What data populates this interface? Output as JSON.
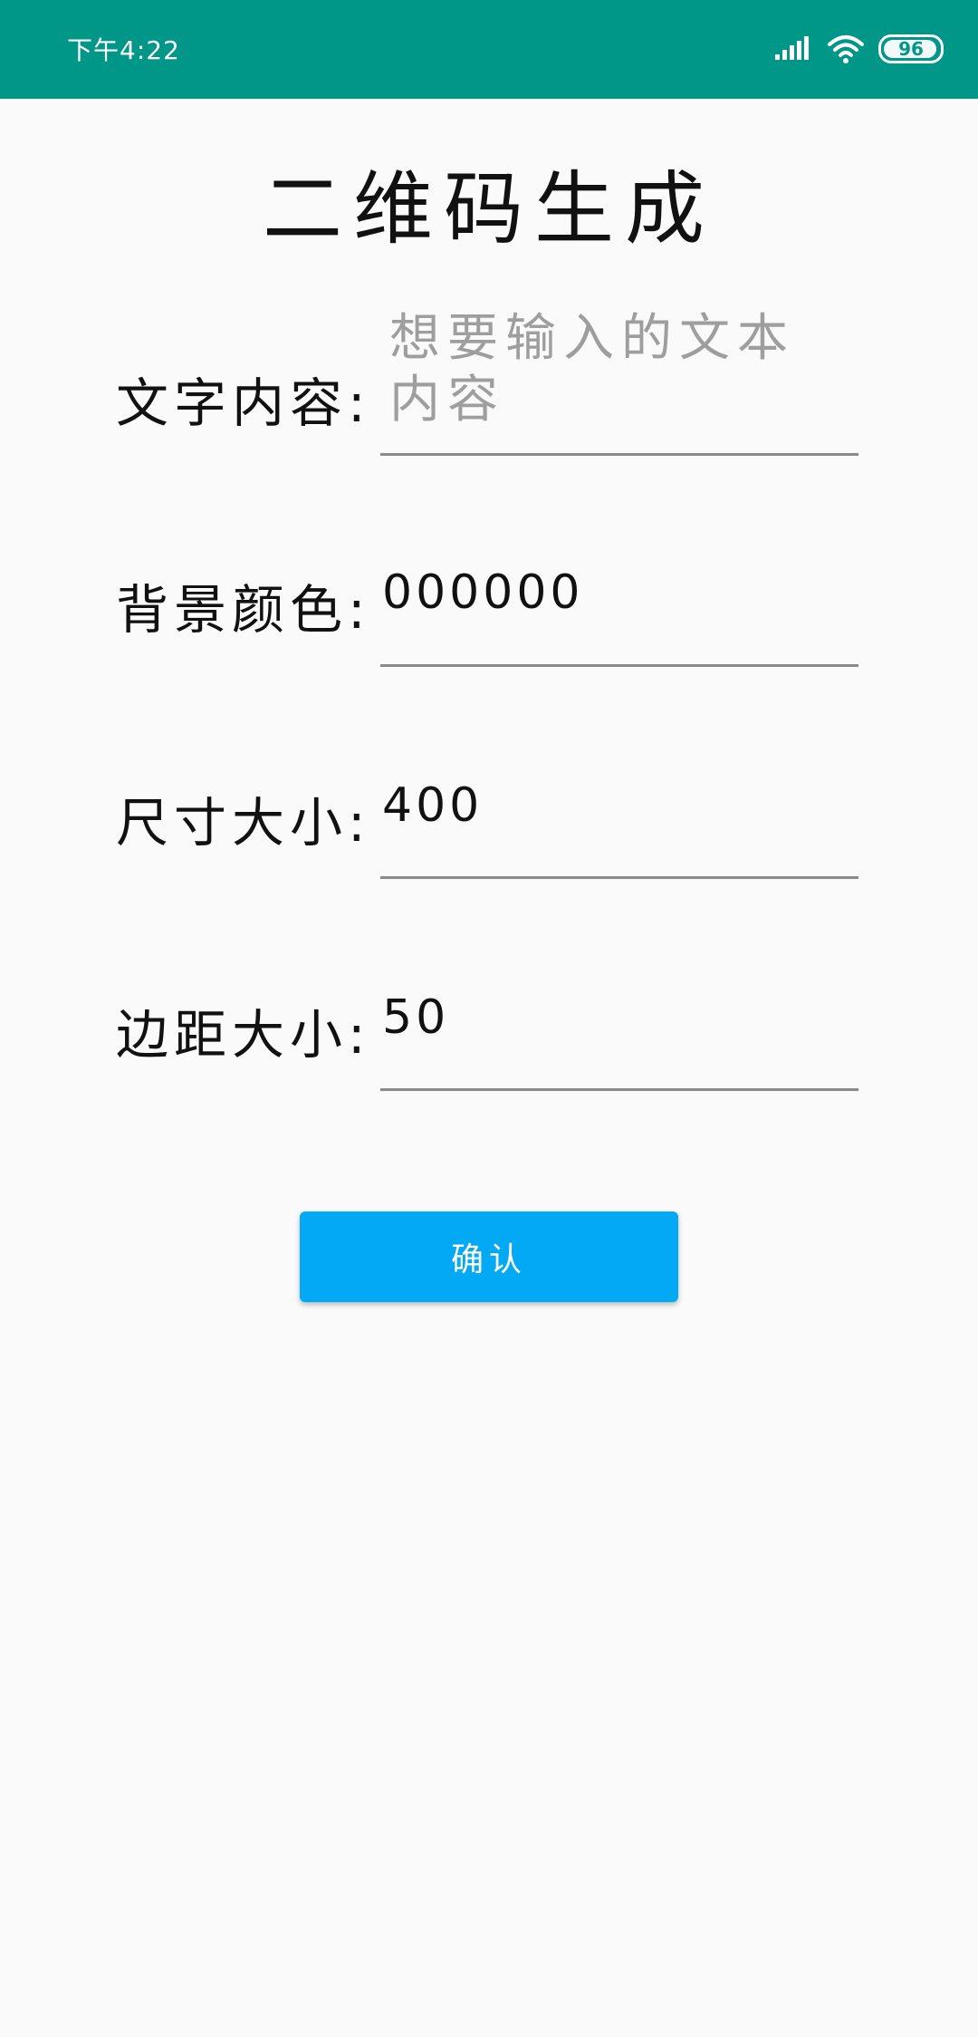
{
  "status_bar": {
    "time": "下午4:22",
    "battery_level": "96",
    "background_color": "#009688"
  },
  "page": {
    "title": "二维码生成"
  },
  "form": {
    "text_content": {
      "label": "文字内容:",
      "value": "",
      "placeholder": "想要输入的文本内容"
    },
    "background_color": {
      "label": "背景颜色:",
      "value": "000000"
    },
    "size": {
      "label": "尺寸大小:",
      "value": "400"
    },
    "margin": {
      "label": "边距大小:",
      "value": "50"
    }
  },
  "confirm_button": {
    "label": "确认",
    "color": "#03a9f4"
  }
}
